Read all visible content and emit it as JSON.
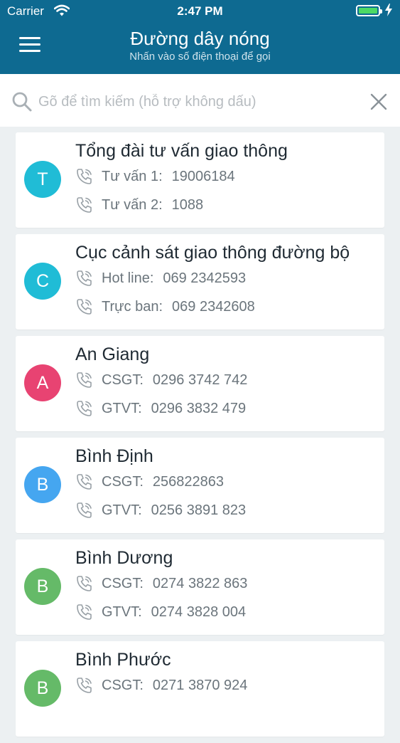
{
  "status_bar": {
    "carrier": "Carrier",
    "time": "2:47 PM"
  },
  "header": {
    "title": "Đường dây nóng",
    "subtitle": "Nhấn vào số điện thoại để gọi"
  },
  "search": {
    "placeholder": "Gõ để tìm kiếm (hỗ trợ không dấu)",
    "value": ""
  },
  "contacts": [
    {
      "initial": "T",
      "color": "#20bcd6",
      "name": "Tổng đài tư vấn giao thông",
      "phones": [
        {
          "label": "Tư vấn 1:",
          "number": "19006184"
        },
        {
          "label": "Tư vấn 2:",
          "number": "1088"
        }
      ]
    },
    {
      "initial": "C",
      "color": "#20bcd6",
      "name": "Cục cảnh sát giao thông đường bộ",
      "phones": [
        {
          "label": "Hot line:",
          "number": "069 2342593"
        },
        {
          "label": "Trực ban:",
          "number": "069 2342608"
        }
      ]
    },
    {
      "initial": "A",
      "color": "#e84372",
      "name": "An Giang",
      "phones": [
        {
          "label": "CSGT:",
          "number": "0296 3742 742"
        },
        {
          "label": "GTVT:",
          "number": "0296 3832 479"
        }
      ]
    },
    {
      "initial": "B",
      "color": "#45a6f0",
      "name": "Bình Định",
      "phones": [
        {
          "label": "CSGT:",
          "number": "256822863"
        },
        {
          "label": "GTVT:",
          "number": "0256 3891 823"
        }
      ]
    },
    {
      "initial": "B",
      "color": "#65ba68",
      "name": "Bình Dương",
      "phones": [
        {
          "label": "CSGT:",
          "number": "0274 3822 863"
        },
        {
          "label": "GTVT:",
          "number": "0274 3828 004"
        }
      ]
    },
    {
      "initial": "B",
      "color": "#65ba68",
      "name": "Bình Phước",
      "phones": [
        {
          "label": "CSGT:",
          "number": "0271 3870 924"
        }
      ]
    }
  ]
}
